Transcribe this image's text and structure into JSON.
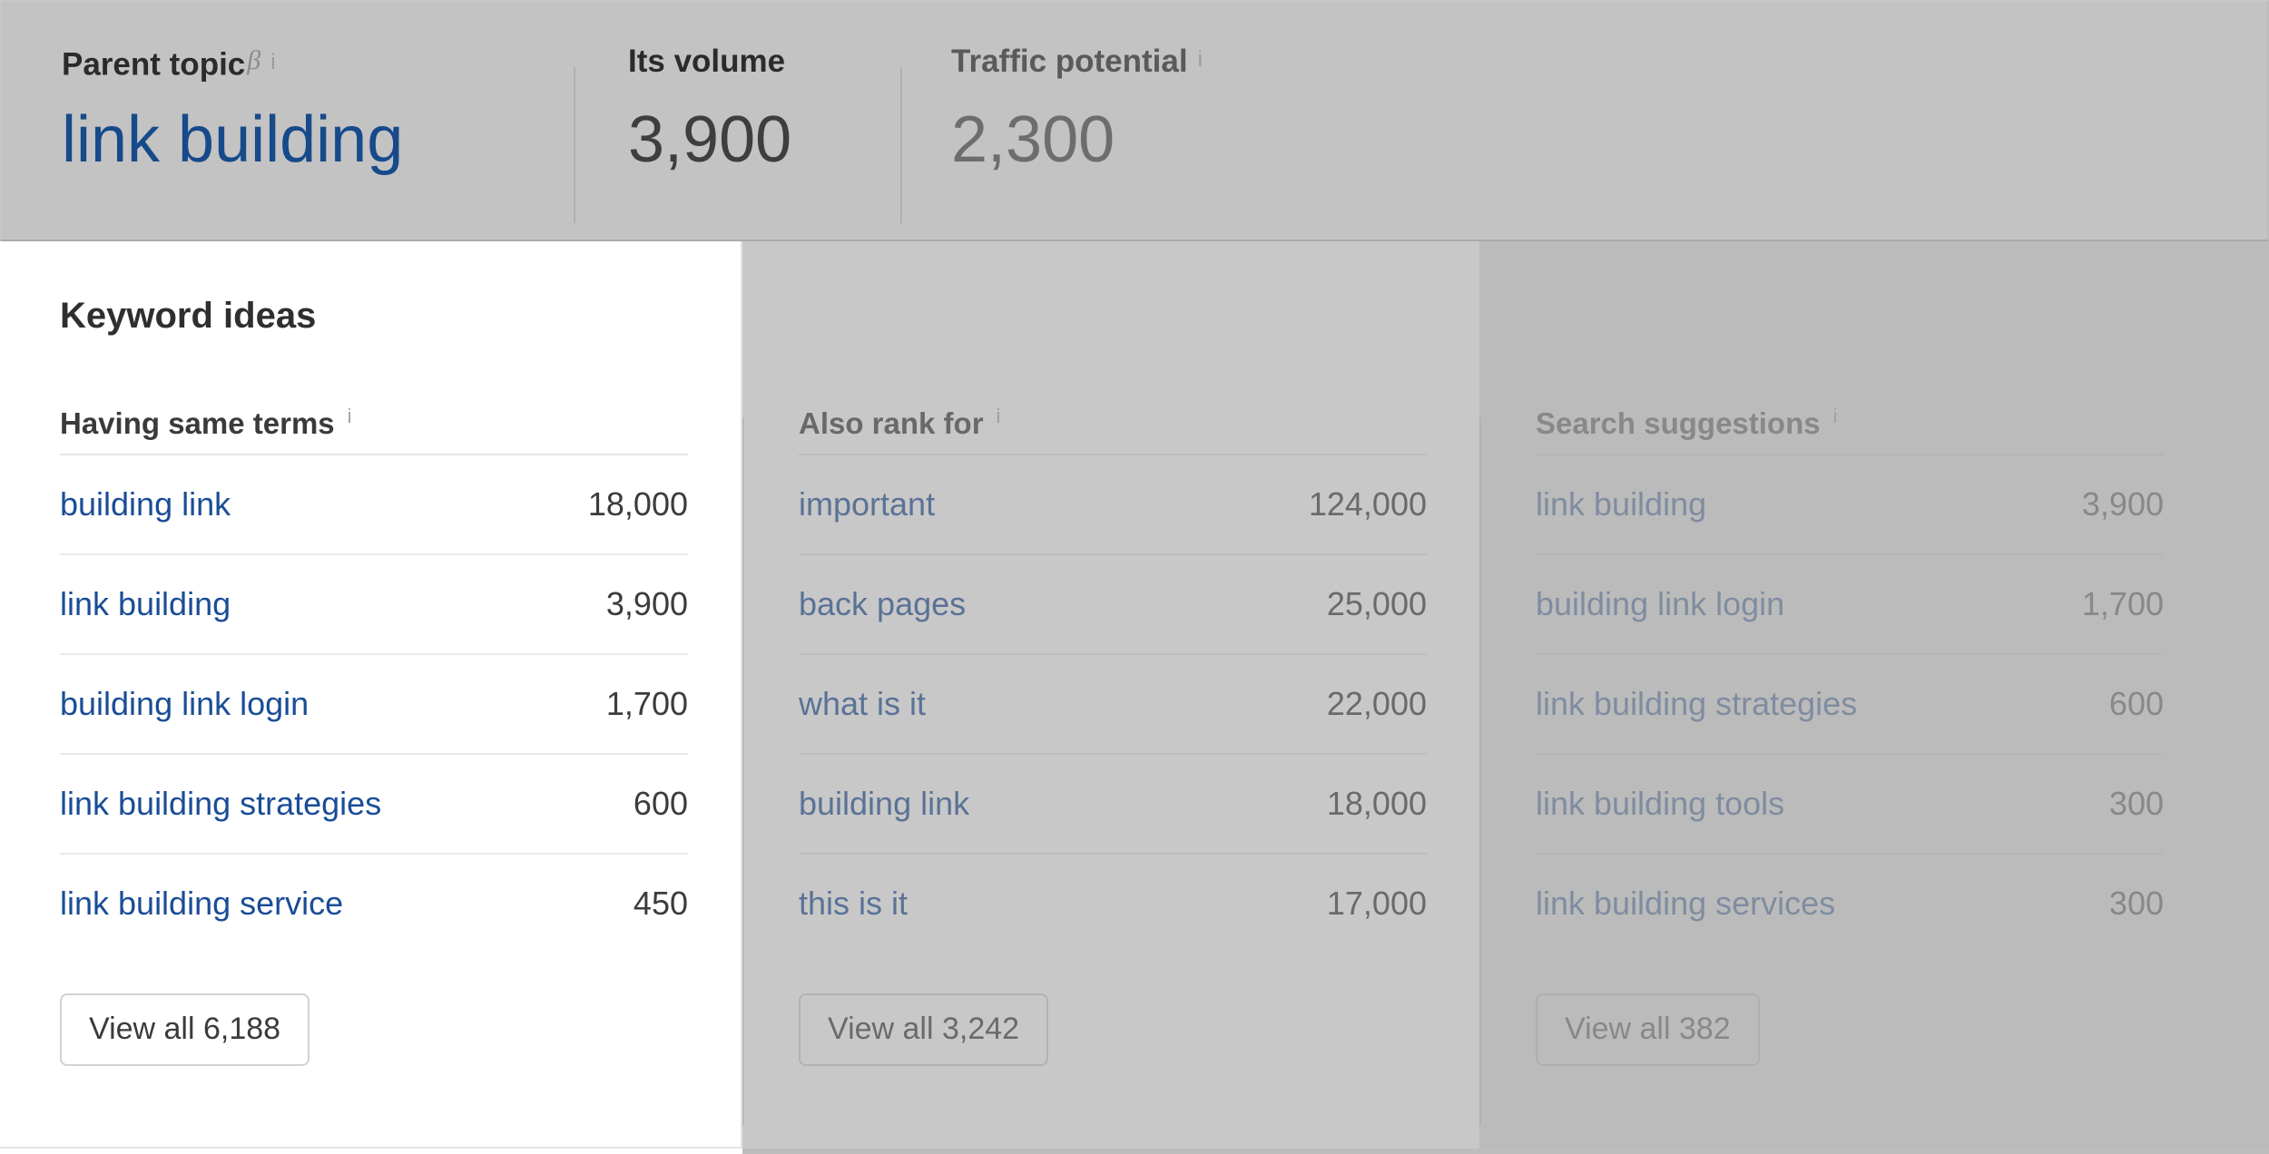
{
  "overview": {
    "metrics": [
      {
        "label": "Parent topic",
        "superscript": "β",
        "info": "i",
        "value": "link building",
        "value_style": "link"
      },
      {
        "label": "Its volume",
        "superscript": "",
        "info": "",
        "value": "3,900",
        "value_style": "dark"
      },
      {
        "label": "Traffic potential",
        "superscript": "",
        "info": "i",
        "value": "2,300",
        "value_style": "grey"
      }
    ]
  },
  "panel": {
    "title": "Keyword ideas",
    "columns": [
      {
        "header": "Having same terms",
        "info": "i",
        "rows": [
          {
            "keyword": "building link",
            "volume": "18,000"
          },
          {
            "keyword": "link building",
            "volume": "3,900"
          },
          {
            "keyword": "building link login",
            "volume": "1,700"
          },
          {
            "keyword": "link building strategies",
            "volume": "600"
          },
          {
            "keyword": "link building service",
            "volume": "450"
          }
        ],
        "view_all": "View all 6,188"
      },
      {
        "header": "Also rank for",
        "info": "i",
        "rows": [
          {
            "keyword": "important",
            "volume": "124,000"
          },
          {
            "keyword": "back pages",
            "volume": "25,000"
          },
          {
            "keyword": "what is it",
            "volume": "22,000"
          },
          {
            "keyword": "building link",
            "volume": "18,000"
          },
          {
            "keyword": "this is it",
            "volume": "17,000"
          }
        ],
        "view_all": "View all 3,242"
      },
      {
        "header": "Search suggestions",
        "info": "i",
        "rows": [
          {
            "keyword": "link building",
            "volume": "3,900"
          },
          {
            "keyword": "building link login",
            "volume": "1,700"
          },
          {
            "keyword": "link building strategies",
            "volume": "600"
          },
          {
            "keyword": "link building tools",
            "volume": "300"
          },
          {
            "keyword": "link building services",
            "volume": "300"
          }
        ],
        "view_all": "View all 382"
      }
    ]
  },
  "colors": {
    "link": "#1a4d97",
    "header_bg": "#c3c3c3",
    "panel_bg": "#ffffff",
    "divider": "#e9e9e9",
    "text_dark": "#3c3c3c"
  }
}
